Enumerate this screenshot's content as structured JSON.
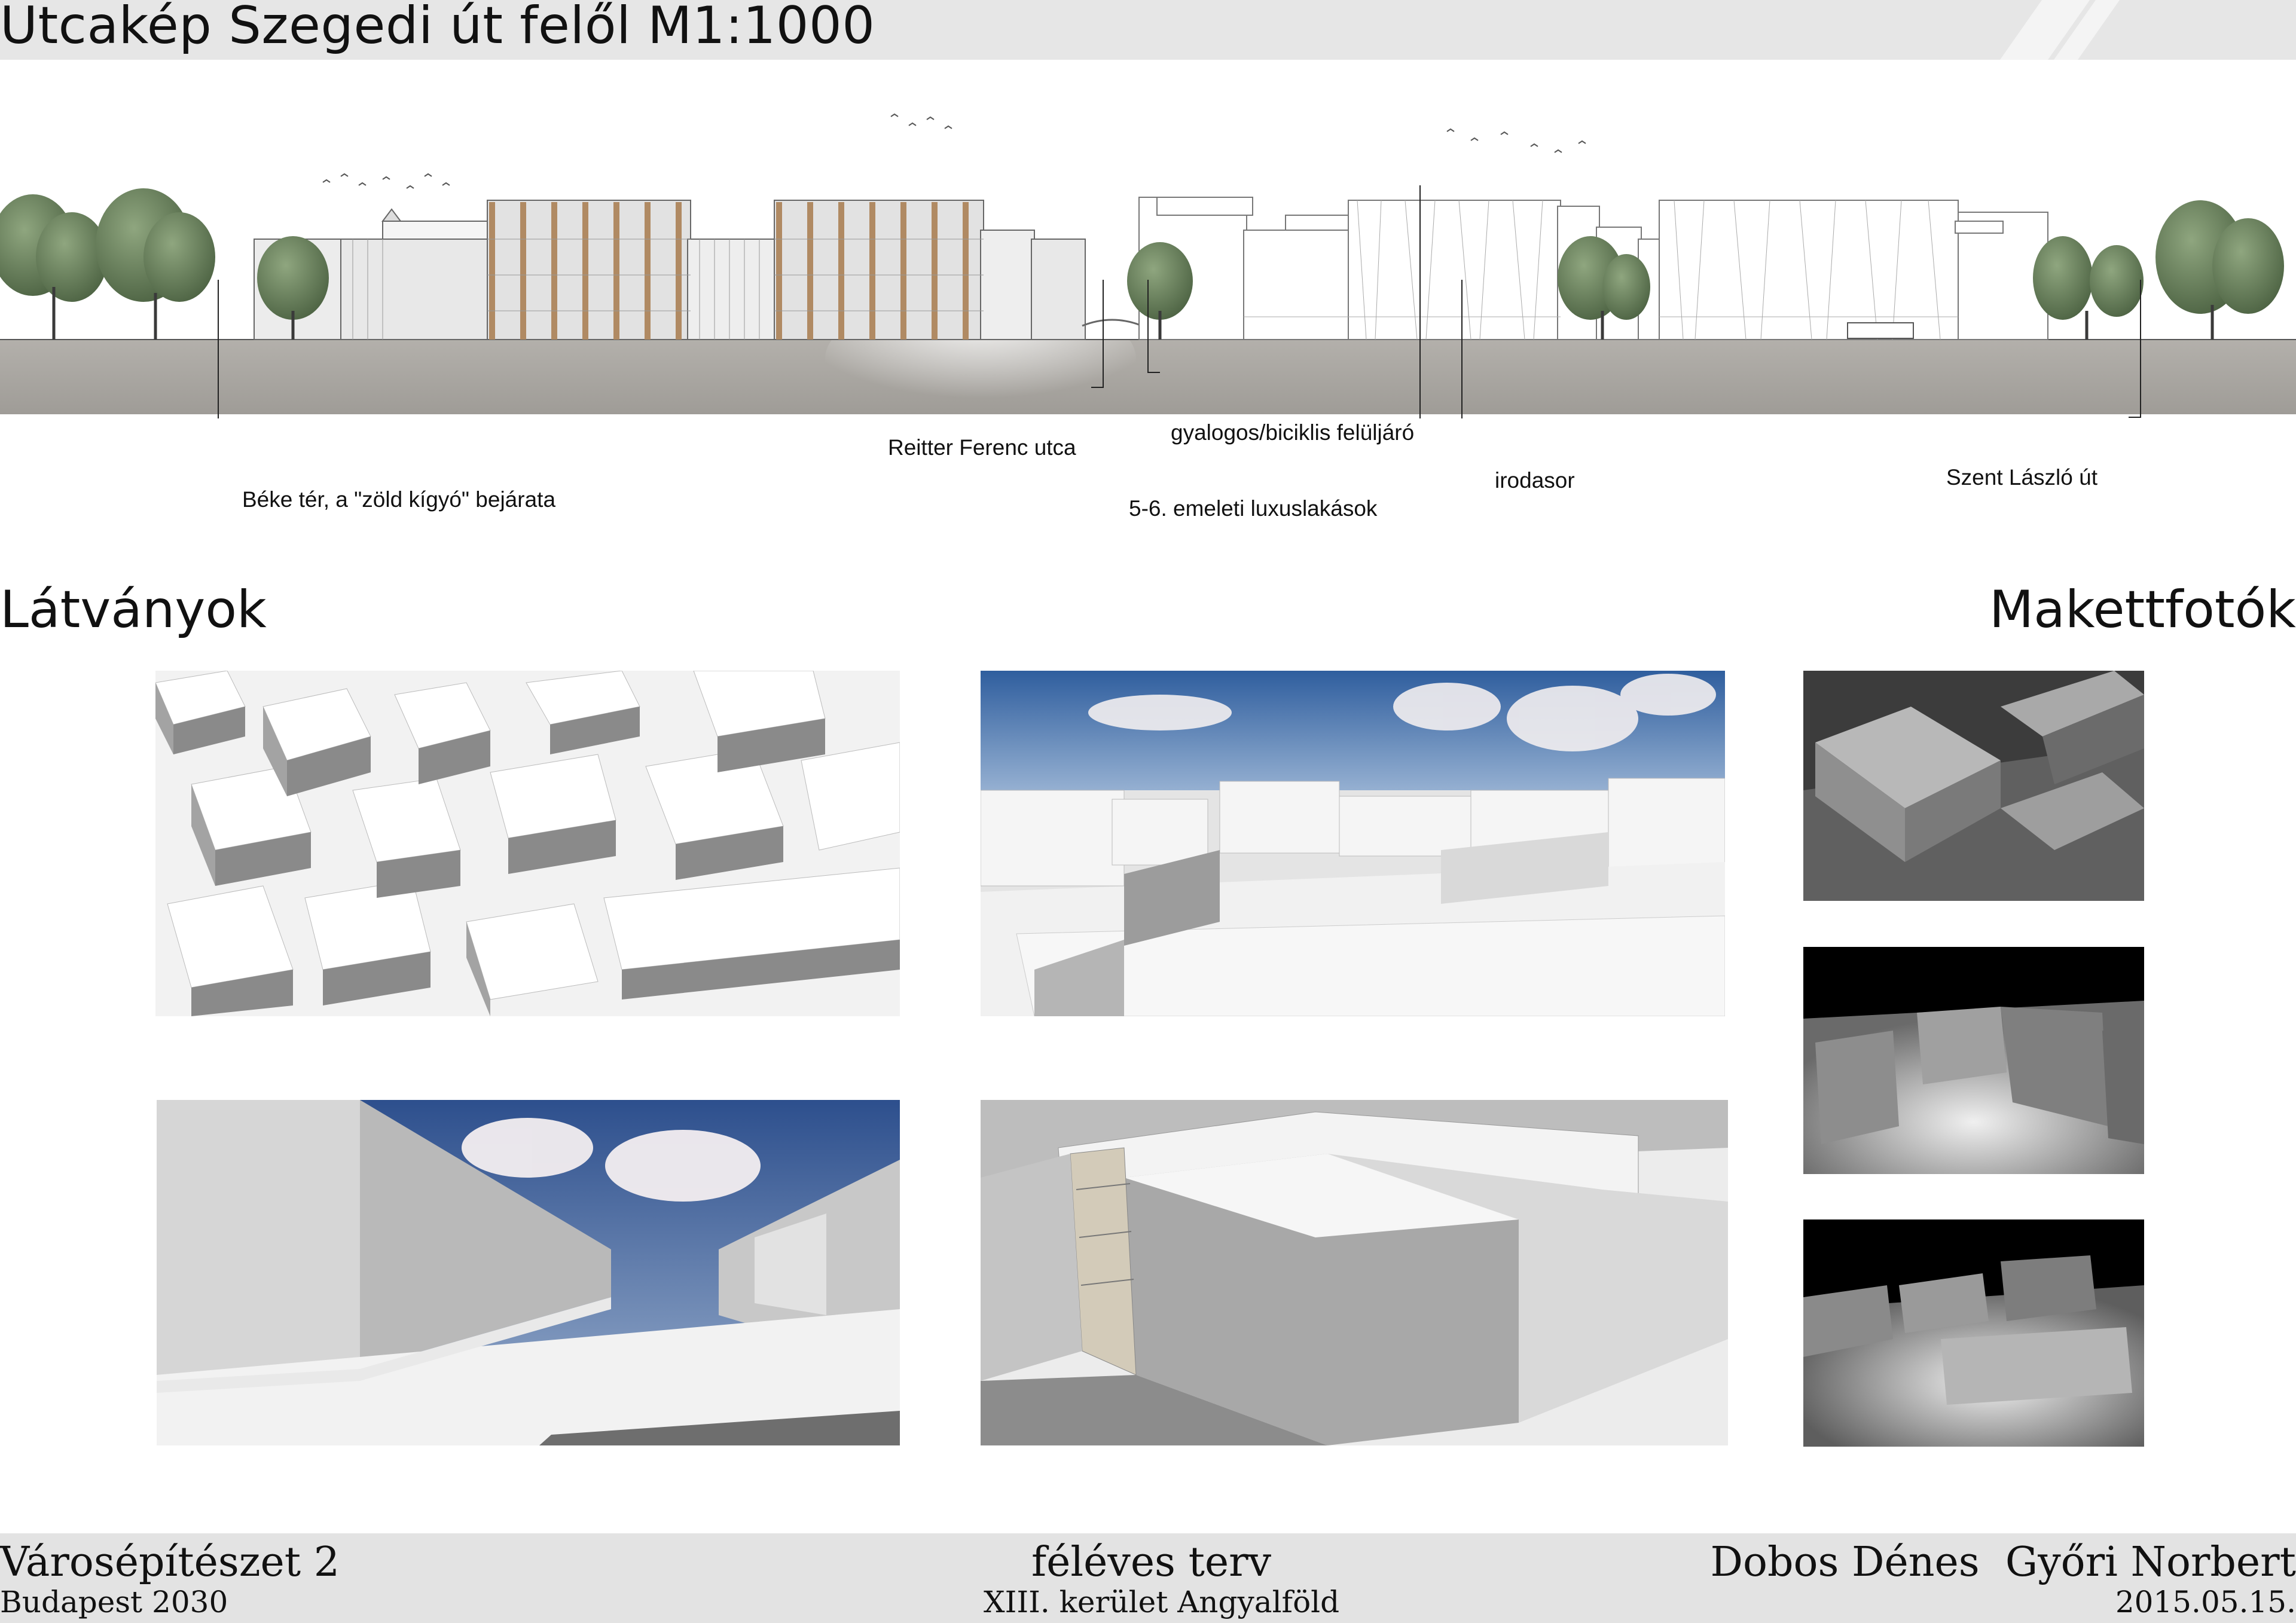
{
  "header": {
    "title": "Utcakép Szegedi út felől M1:1000"
  },
  "elevation": {
    "callouts": [
      {
        "id": "beke-ter",
        "text": "Béke tér, a \"zöld kígyó\" bejárata"
      },
      {
        "id": "reitter",
        "text": "Reitter Ferenc utca"
      },
      {
        "id": "felujaro",
        "text": "gyalogos/biciklis felüljáró"
      },
      {
        "id": "luxus",
        "text": "5-6. emeleti luxuslakások"
      },
      {
        "id": "irodasor",
        "text": "irodasor"
      },
      {
        "id": "szent-laszlo",
        "text": "Szent László út"
      }
    ]
  },
  "sections": {
    "latvanyok": "Látványok",
    "makettfotok": "Makettfotók"
  },
  "footer": {
    "course": "Városépítészet 2",
    "project": "Budapest 2030",
    "plan_type": "féléves terv",
    "district": "XIII. kerület Angyalföld",
    "authors": "Dobos Dénes  Győri Norbert",
    "date": "2015.05.15."
  },
  "colors": {
    "header_band": "#e6e6e6",
    "footer_band": "#e3e3e3",
    "ground": "#a8a5a0",
    "wood_fins": "#b08a63",
    "sky": "#3a6bb0"
  }
}
